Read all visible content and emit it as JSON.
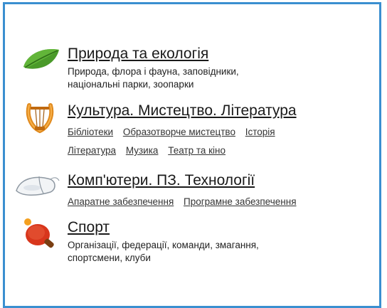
{
  "categories": [
    {
      "title": "Природа та екологія",
      "icon": "leaf-icon",
      "description": [
        "Природа, флора і фауна, заповідники,",
        "національні парки, зоопарки"
      ]
    },
    {
      "title": "Культура. Мистецтво. Література",
      "icon": "lyre-icon",
      "links": [
        [
          "Бібліотеки",
          "Образотворче мистецтво",
          "Історія"
        ],
        [
          "Література",
          "Музика",
          "Театр та кіно"
        ]
      ]
    },
    {
      "title": "Комп'ютери. ПЗ. Технології",
      "icon": "computer-mouse-icon",
      "links": [
        [
          "Апаратне забезпечення",
          "Програмне забезпечення"
        ]
      ]
    },
    {
      "title": "Спорт",
      "icon": "table-tennis-icon",
      "description": [
        "Організації, федерації, команди, змагання,",
        "спортсмени, клуби"
      ]
    }
  ],
  "colors": {
    "border": "#3a8fd0",
    "leaf": "#4a9a2a",
    "lyre": "#e08a1e",
    "paddle": "#d8361c"
  }
}
